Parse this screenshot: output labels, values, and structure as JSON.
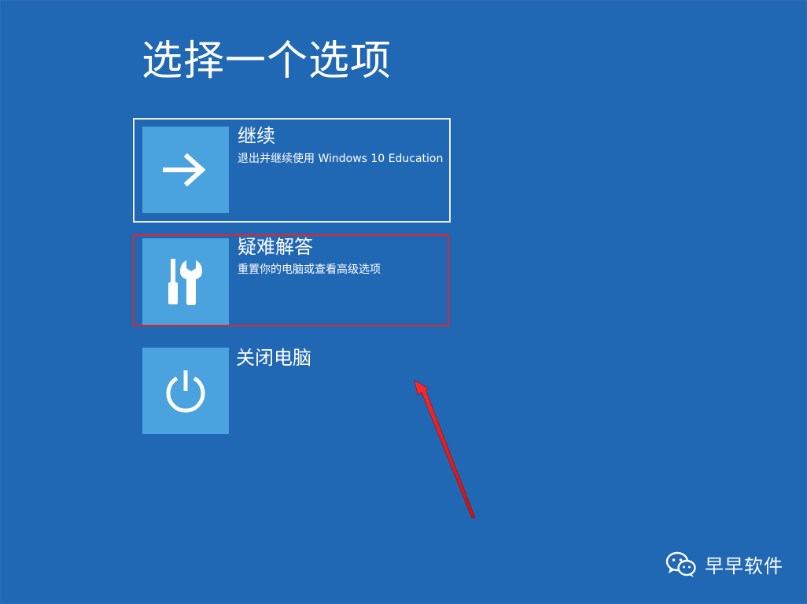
{
  "page": {
    "title": "选择一个选项",
    "background_color": "#2067b4",
    "tile_color": "#4aa2df",
    "annotation_color": "#e3242b"
  },
  "options": [
    {
      "label": "继续",
      "description": "退出并继续使用 Windows 10 Education",
      "icon": "arrow-right-icon",
      "state": "focused"
    },
    {
      "label": "疑难解答",
      "description": "重置你的电脑或查看高级选项",
      "icon": "tools-icon",
      "state": "highlighted"
    },
    {
      "label": "关闭电脑",
      "description": "",
      "icon": "power-icon",
      "state": "normal"
    }
  ],
  "watermark": {
    "text": "早早软件",
    "icon": "wechat-icon"
  }
}
